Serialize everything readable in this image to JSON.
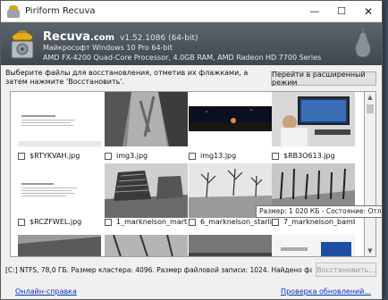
{
  "window": {
    "title": "Piriform Recuva",
    "min": "—",
    "max": "☐",
    "close": "✕"
  },
  "header": {
    "name": "Recuva",
    "domain": ".com",
    "version": "v1.52.1086 (64-bit)",
    "os": "Майкрософт Windows 10 Pro 64-bit",
    "hardware": "AMD FX-4200 Quad-Core Processor, 4.0GB RAM, AMD Radeon HD 7700 Series"
  },
  "instruction": "Выберите файлы для восстановления, отметив их флажками, а затем нажмите 'Восстановить'.",
  "advanced_button": "Перейти в расширенный режим",
  "files": [
    {
      "name": "$RTYKVAH.jpg",
      "checked": false
    },
    {
      "name": "img3.jpg",
      "checked": false
    },
    {
      "name": "img13.jpg",
      "checked": false
    },
    {
      "name": "$RB3O613.jpg",
      "checked": false
    },
    {
      "name": "$RCZFWEL.jpg",
      "checked": false
    },
    {
      "name": "1_marknelson_marti...",
      "checked": false
    },
    {
      "name": "6_marknelson_starlin...",
      "checked": false
    },
    {
      "name": "7_marknelson_bamb...",
      "checked": false
    }
  ],
  "tooltip": "Размер: 1 020 КБ - Состояние: Отличное",
  "status": "[C:] NTFS, 78,0 ГБ. Размер кластера: 4096. Размер файловой записи: 1024. Найдено файлов: 9...",
  "recover_button": "Восстановить...",
  "links": {
    "help": "Онлайн-справка",
    "updates": "Проверка обновлений..."
  },
  "scrollbar": {
    "up": "▲",
    "down": "▼"
  }
}
